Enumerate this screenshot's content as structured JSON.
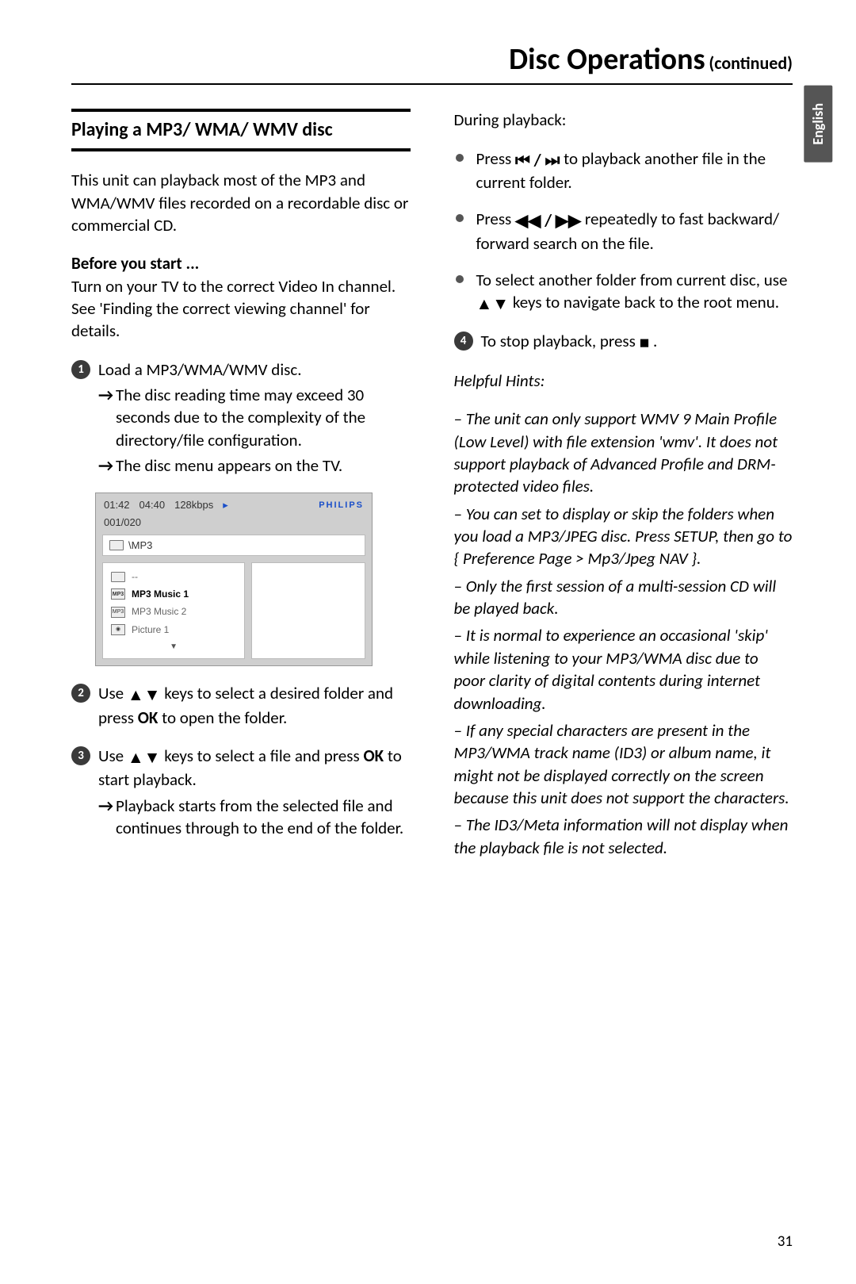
{
  "header": {
    "title_main": "Disc Operations",
    "title_suffix": "(continued)"
  },
  "lang_tab": "English",
  "left": {
    "section_heading": "Playing a MP3/ WMA/ WMV disc",
    "intro": "This unit can playback most of the MP3 and WMA/WMV files recorded on a recordable disc or commercial CD.",
    "before_label": "Before you start ...",
    "before_text": "Turn on your TV to the correct Video In channel. See 'Finding the correct viewing channel' for details.",
    "step1_line": "Load a MP3/WMA/WMV disc.",
    "step1_arrow1": "The disc reading time may exceed 30 seconds due to the complexity of the directory/file configuration.",
    "step1_arrow2": "The disc menu appears on the TV.",
    "menu": {
      "time_elapsed": "01:42",
      "time_total": "04:40",
      "bitrate": "128kbps",
      "brand": "PHILIPS",
      "count": "001/020",
      "path": "\\MP3",
      "row_dash": "--",
      "row1": "MP3 Music 1",
      "row2": "MP3 Music 2",
      "row3": "Picture 1"
    },
    "step2_a": "Use ",
    "step2_b": " keys to select a desired folder and press ",
    "step2_ok": "OK",
    "step2_c": " to open the folder.",
    "step3_a": "Use ",
    "step3_b": " keys to select a file and press ",
    "step3_ok": "OK",
    "step3_c": " to start playback.",
    "step3_arrow": "Playback starts from the selected file and continues through to the end of the folder."
  },
  "right": {
    "during": "During playback:",
    "b1_a": "Press ",
    "b1_b": "   to playback another file in the current folder.",
    "b2_a": "Press ",
    "b2_b": " repeatedly to fast backward/ forward search on the file.",
    "b3_a": "To select another folder from current disc, use ",
    "b3_b": " keys to navigate back to the root menu.",
    "step4_a": "To stop playback, press ",
    "step4_b": ".",
    "hints_head": "Helpful Hints:",
    "h1": "–  The unit can only support WMV 9 Main Profile (Low Level) with file extension 'wmv'. It does not support playback of Advanced Profile and DRM-protected video files.",
    "h2": "–  You can set to display or skip the folders when you load a MP3/JPEG disc. Press SETUP, then go to { Preference Page > Mp3/Jpeg NAV }.",
    "h3": "–  Only the first session of a multi-session CD will be played back.",
    "h4": "–  It is normal to experience an occasional 'skip' while listening to your MP3/WMA disc due to poor clarity of digital contents during internet downloading.",
    "h5": "–  If any special characters are present in the MP3/WMA track name (ID3) or album name, it might not be displayed correctly on the screen because this unit does not support the characters.",
    "h6": "–  The ID3/Meta information will not display when the playback file is not selected."
  },
  "page_number": "31"
}
